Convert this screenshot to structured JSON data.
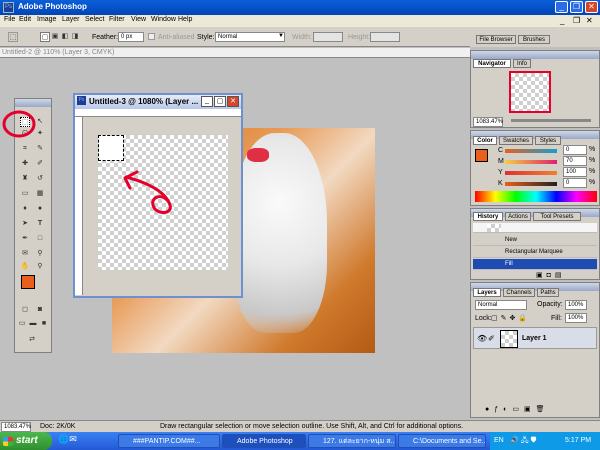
{
  "app": {
    "title": "Adobe Photoshop"
  },
  "menu": [
    "File",
    "Edit",
    "Image",
    "Layer",
    "Select",
    "Filter",
    "View",
    "Window",
    "Help"
  ],
  "options": {
    "feather_label": "Feather:",
    "feather_value": "0 px",
    "antialiased": "Anti-aliased",
    "style_label": "Style:",
    "style_value": "Normal",
    "width_label": "Width:",
    "height_label": "Height:"
  },
  "well_tabs": [
    "File Browser",
    "Brushes"
  ],
  "doc_bg": {
    "title": "Untitled-2 @ 110% (Layer 3, CMYK)"
  },
  "doc": {
    "title": "Untitled-3 @ 1080% (Layer ..."
  },
  "navigator": {
    "tabs": [
      "Navigator",
      "Info"
    ],
    "zoom": "1083.47%"
  },
  "color": {
    "tabs": [
      "Color",
      "Swatches",
      "Styles"
    ],
    "channels": [
      {
        "name": "C",
        "value": "0",
        "unit": "%"
      },
      {
        "name": "M",
        "value": "70",
        "unit": "%"
      },
      {
        "name": "Y",
        "value": "100",
        "unit": "%"
      },
      {
        "name": "K",
        "value": "0",
        "unit": "%"
      }
    ],
    "fg": "#e8601c"
  },
  "history": {
    "tabs": [
      "History",
      "Actions",
      "Tool Presets"
    ],
    "items": [
      "New",
      "Rectangular Marquee",
      "Fill"
    ]
  },
  "layers": {
    "tabs": [
      "Layers",
      "Channels",
      "Paths"
    ],
    "mode": "Normal",
    "opacity_label": "Opacity:",
    "opacity": "100%",
    "lock_label": "Lock:",
    "fill_label": "Fill:",
    "fill": "100%",
    "layer_name": "Layer 1"
  },
  "status": {
    "zoom": "1083.47%",
    "doc": "Doc: 2K/0K",
    "hint": "Draw rectangular selection or move selection outline. Use Shift, Alt, and Ctrl for additional options."
  },
  "taskbar": {
    "start": "start",
    "tasks": [
      "###PANTIP.COM##...",
      "Adobe Photoshop",
      "127. แต่ละยาก-หนุ่ม ส...",
      "C:\\Documents and Se..."
    ],
    "lang": "EN",
    "clock": "5:17 PM"
  }
}
